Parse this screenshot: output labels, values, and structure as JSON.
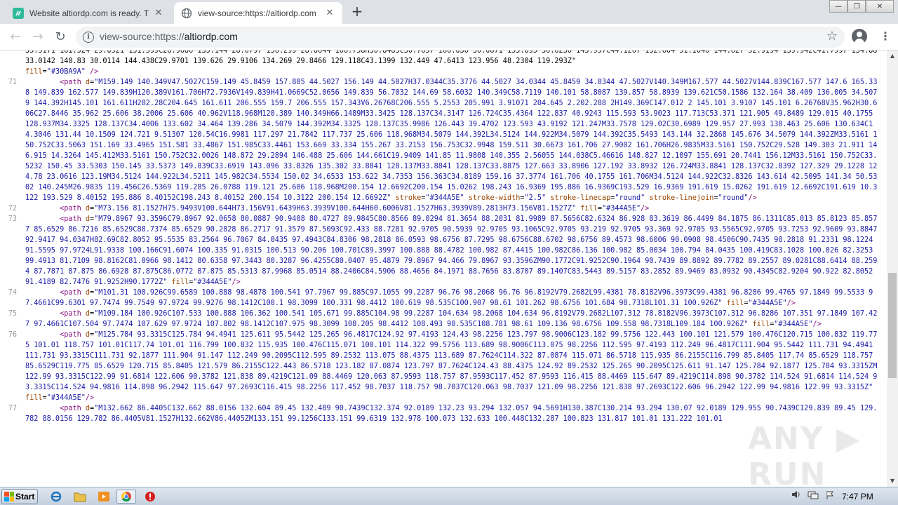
{
  "browser": {
    "tabs": [
      {
        "title": "Website altiordp.com is ready. The c",
        "active": false
      },
      {
        "title": "view-source:https://altiordp.com",
        "active": true
      }
    ],
    "new_tab": "+",
    "address": {
      "prefix": "view-source:https://",
      "domain": "altiordp.com"
    },
    "window_controls": {
      "minimize": "—",
      "maximize": "❐",
      "close": "✕"
    },
    "nav": {
      "back": "←",
      "forward": "→",
      "reload": "↻"
    },
    "bookmark": "☆",
    "menu": "⋮"
  },
  "source": {
    "lines": [
      {
        "num": "",
        "cut": true,
        "html": "35.5171 161.524 29.0521 151.599C28.9686 135.144 28.0797 136.299 28.8644 166.758H30.8485C30.7657 166.036 30.0871 155.895 36.6236 145.957C44.1267 132.604 51.1646 144.627 52.9194 139.942C41.7997 134.88 33.0142 140.83 30.0114 144.438C29.9701 139.626 29.9106 134.269 29.8466 129.118C43.1399 132.449 47.6413 123.956 48.2304 119.293Z\""
      },
      {
        "num": "",
        "html": "<span class=\"attr\">fill</span>=<span class=\"val\">\"#30BA9A\"</span> <span class=\"tag\">/&gt;</span>"
      },
      {
        "num": "71",
        "html": "        <span class=\"tag\">&lt;path</span> <span class=\"attr\">d</span>=<span class=\"val\">\"M159.149 140.349V47.5027C159.149 45.8459 157.805 44.5027 156.149 44.5027H37.0344C35.3776 44.5027 34.0344 45.8459 34.0344 47.5027V140.349M167.577 44.5027V144.839C167.577 147.6 165.338 149.839 162.577 149.839H120.389V161.706H72.7936V149.839H41.0669C52.0656 149.839 56.7032 144.69 58.6032 140.349C58.7119 140.101 58.8087 139.857 58.8939 139.621C50.1586 132.164 38.409 136.005 34.5079 144.392H145.101 161.611H202.28C204.645 161.611 206.555 159.7 206.555 157.343V6.26768C206.555 5.2553 205.991 3.91071 204.645 2.202.288 2H149.369C147.012 2 145.101 3.9107 145.101 6.26768V35.962H30.606C27.8446 35.962 25.606 38.2006 25.606 40.962V118.968M120.389 140.349H66.1489M33.3425 128.137C34.3147 126.724C35.4364 122.837 40.9243 115.593 53.9023 117.713C53.371 121.905 49.8489 129.015 40.1755 128.937M34.3325 128.137C34.4006 133.602 34.464 139.286 34.5079 144.392M34.3325 128.137C35.9986 126.443 39.4702 123.593 43.9192 121.247M33.7578 129.02C30.6989 129.957 27.993 130.463 25.606 130.634C14.3046 131.44 10.1509 124.721 9.51307 120.54C16.9981 117.297 21.7842 117.737 25.606 118.968M34.5079 144.392L34.5124 144.922M34.5079 144.392C35.5493 143.144 32.2868 145.676 34.5079 144.392ZM33.5161 150.752C33.5063 151.169 33.4965 151.581 33.4867 151.985C33.4461 153.669 33.334 155.267 33.2153 156.753C32.9948 159.511 30.6673 161.706 27.9002 161.706H26.9835M33.5161 150.752C29.528 149.303 21.911 146.915 14.3264 145.412M33.5161 150.752C32.0026 148.872 29.2894 146.488 25.606 144.661C19.9409 141.85 11.9808 140.355 2.56055 144.038C5.46616 148.827 12.1097 155.691 20.7441 156.12M33.5161 150.752C33.5232 150.45 33.5303 150.145 33.5373 149.839C33.6919 143.096 33.8326 135.302 33.8841 128.137M33.8841 128.137C33.8875 127.663 33.8906 127.192 33.8932 126.724M33.8841 128.137C32.8392 127.329 29.1228 124.78 23.0616 123.19M34.5124 144.922L34.5211 145.982C34.5534 150.02 34.6533 153.622 34.7353 156.363C34.8189 159.16 37.3774 161.706 40.1755 161.706M34.5124 144.922C32.8326 143.614 42.5095 141.34 50.5302 140.245M26.9835 119.456C26.5369 119.285 26.0788 119.121 25.606 118.968M200.154 12.6692C200.154 15.0262 198.243 16.9369 195.886 16.9369C193.529 16.9369 191.619 15.0262 191.619 12.6692C191.619 10.3122 193.529 8.40152 195.886 8.40152C198.243 8.40152 200.154 10.3122 200.154 12.6692Z\"</span> <span class=\"attr\">stroke</span>=<span class=\"val\">\"#344A5E\"</span> <span class=\"attr\">stroke-width</span>=<span class=\"val\">\"2.5\"</span> <span class=\"attr\">stroke-linecap</span>=<span class=\"val\">\"round\"</span> <span class=\"attr\">stroke-linejoin</span>=<span class=\"val\">\"round\"</span><span class=\"tag\">/&gt;</span>"
      },
      {
        "num": "72",
        "html": "        <span class=\"tag\">&lt;path</span> <span class=\"attr\">d</span>=<span class=\"val\">\"M73.156 81.1527H75.9493V100.644H73.156V91.6439H63.3939V100.644H60.6006V81.1527H63.3939V89.2813H73.156V81.1527Z\"</span> <span class=\"attr\">fill</span>=<span class=\"val\">\"#344A5E\"</span><span class=\"tag\">/&gt;</span>"
      },
      {
        "num": "73",
        "html": "        <span class=\"tag\">&lt;path</span> <span class=\"attr\">d</span>=<span class=\"val\">\"M79.8967 93.3596C79.8967 92.0658 80.0887 90.9408 80.4727 89.9845C80.8566 89.0294 81.3654 88.2031 81.9989 87.5656C82.6324 86.928 83.3619 86.4499 84.1875 86.1311C85.013 85.8123 85.8577 85.6529 86.7216 85.6529C88.7374 85.6529 90.2828 86.2717 91.3579 87.5093C92.433 88.7281 92.9705 90.5939 92.9705 93.1065C92.9705 93.219 92.9705 93.369 92.9705 93.5565C92.9705 93.7253 92.9609 93.8847 92.9417 94.0347H82.69C82.8052 95.5535 83.2564 96.7067 84.0435 97.4943C84.8306 98.2818 86.0593 98.6756 87.7295 98.6756C88.6702 98.6756 89.4573 98.6006 90.0908 98.4506C90.7435 98.2818 91.2331 98.1224 91.5595 97.9724L91.9338 100.166C91.6074 100.335 91.0315 100.513 90.206 100.701C89.3997 100.888 88.4782 100.982 87.4415 100.982C86.136 100.982 85.0034 100.794 84.0435 100.419C83.1028 100.026 82.3253 99.4913 81.7109 98.8162C81.0966 98.1412 80.6358 97.3443 80.3287 96.4255C80.0407 95.4879 79.8967 94.466 79.8967 93.3596ZM90.1772C91.9252C90.1964 90.7439 89.8892 89.7782 89.2557 89.0281C88.6414 88.2594 87.7871 87.875 86.6928 87.875C86.0772 87.875 85.5313 87.9968 85.0514 88.2406C84.5906 88.4656 84.1971 88.7656 83.8707 89.1407C83.5443 89.5157 83.2852 89.9469 83.0932 90.4345C82.9204 90.922 82.8052 91.4189 82.7476 91.9252H90.1772Z\"</span> <span class=\"attr\">fill</span>=<span class=\"val\">\"#344A5E\"</span><span class=\"tag\">/&gt;</span>"
      },
      {
        "num": "74",
        "html": "        <span class=\"tag\">&lt;path</span> <span class=\"attr\">d</span>=<span class=\"val\">\"M101.31 100.926C99.6589 100.888 98.4878 100.541 97.7967 99.885C97.1055 99.2287 96.76 98.2068 96.76 96.8192V79.2682L99.4381 78.8182V96.3973C99.4381 96.8286 99.4765 97.1849 99.5533 97.4661C99.6301 97.7474 99.7549 97.9724 99.9276 98.1412C100.1 98.3099 100.331 98.4412 100.619 98.535C100.907 98.61 101.262 98.6756 101.684 98.7318L101.31 100.926Z\"</span> <span class=\"attr\">fill</span>=<span class=\"val\">\"#344A5E\"</span><span class=\"tag\">/&gt;</span>"
      },
      {
        "num": "75",
        "html": "        <span class=\"tag\">&lt;path</span> <span class=\"attr\">d</span>=<span class=\"val\">\"M109.184 100.926C107.533 100.888 106.362 100.541 105.671 99.885C104.98 99.2287 104.634 98.2068 104.634 96.8192V79.2682L107.312 78.8182V96.3973C107.312 96.8286 107.351 97.1849 107.427 97.4661C107.504 97.7474 107.629 97.9724 107.802 98.1412C107.975 98.3099 108.205 98.4412 108.493 98.535C108.781 98.61 109.136 98.6756 109.558 98.7318L109.184 100.926Z\"</span> <span class=\"attr\">fill</span>=<span class=\"val\">\"#344A5E\"</span><span class=\"tag\">/&gt;</span>"
      },
      {
        "num": "76",
        "html": "        <span class=\"tag\">&lt;path</span> <span class=\"attr\">d</span>=<span class=\"val\">\"M125.784 93.3315C125.784 94.4941 125.611 95.5442 125.265 96.4817C124.92 97.4193 124.43 98.2256 123.797 98.9006C123.182 99.5756 122.443 100.101 121.579 100.476C120.715 100.832 119.775 101.01 118.757 101.01C117.74 101.01 116.799 100.832 115.935 100.476C115.071 100.101 114.322 99.5756 113.689 98.9006C113.075 98.2256 112.595 97.4193 112.249 96.4817C111.904 95.5442 111.731 94.4941 111.731 93.3315C111.731 92.1877 111.904 91.147 112.249 90.2095C112.595 89.2532 113.075 88.4375 113.689 87.7624C114.322 87.0874 115.071 86.5718 115.935 86.2155C116.799 85.8405 117.74 85.6529 118.757 85.6529C119.775 85.6529 120.715 85.8405 121.579 86.2155C122.443 86.5718 123.182 87.0874 123.797 87.7624C124.43 88.4375 124.92 89.2532 125.265 90.2095C125.611 91.147 125.784 92.1877 125.784 93.3315ZM122.99 93.3315C122.99 91.6814 122.606 90.3782 121.838 89.4219C121.09 88.4469 120.063 87.9593 118.757 87.9593C117.452 87.9593 116.415 88.4469 115.647 89.4219C114.898 90.3782 114.524 91.6814 114.524 93.3315C114.524 94.9816 114.898 96.2942 115.647 97.2693C116.415 98.2256 117.452 98.7037 118.757 98.7037C120.063 98.7037 121.09 98.2256 121.838 97.2693C122.606 96.2942 122.99 94.9816 122.99 93.3315Z\"</span>"
      },
      {
        "num": "",
        "html": "<span class=\"attr\">fill</span>=<span class=\"val\">\"#344A5E\"</span><span class=\"tag\">/&gt;</span>"
      },
      {
        "num": "77",
        "html": "        <span class=\"tag\">&lt;path</span> <span class=\"attr\">d</span>=<span class=\"val\">\"M132.662 86.4405C132.662 88.0156 132.604 89.45 132.489 90.7439C132.374 92.0189 132.23 93.294 132.057 94.5691H130.387C130.214 93.294 130.07 92.0189 129.955 90.7439C129.839 89.45 129.782 88.0156 129.782 86.4405V81.1527H132.662V86.4405ZM133.151 99.1256C133.151 99.6319 132.978 100.073 132.633 100.448C132.287 100.823 131.817 101.01 131.222 101.01</span>"
      }
    ]
  },
  "watermark": "ANY ▶ RUN",
  "taskbar": {
    "start_label": "Start",
    "clock": "7:47 PM"
  }
}
